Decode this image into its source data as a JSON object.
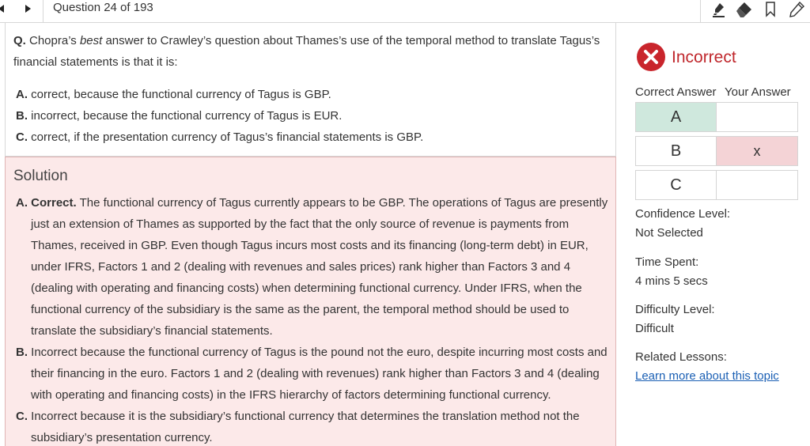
{
  "header": {
    "question_counter": "Question 24 of 193",
    "icons": [
      "triangle-left-icon",
      "triangle-right-icon",
      "highlighter-icon",
      "eraser-icon",
      "bookmark-icon",
      "pencil-icon"
    ]
  },
  "question": {
    "prefix": "Q.",
    "stem_before": " Chopra’s ",
    "stem_emphasis": "best",
    "stem_after": " answer to Crawley’s question about Thames’s use of the temporal method to translate Tagus’s financial statements is that it is:",
    "choices": [
      {
        "letter": "A.",
        "text": " correct, because the functional currency of Tagus is GBP."
      },
      {
        "letter": "B.",
        "text": " incorrect, because the functional currency of Tagus is EUR."
      },
      {
        "letter": "C.",
        "text": " correct, if the presentation currency of Tagus’s financial statements is GBP."
      }
    ]
  },
  "solution": {
    "title": "Solution",
    "items": [
      {
        "letter": "A.",
        "lead": " Correct.",
        "text": " The functional currency of Tagus currently appears to be GBP. The operations of Tagus are presently just an extension of Thames as supported by the fact that the only source of revenue is payments from Thames, received in GBP. Even though Tagus incurs most costs and its financing (long-term debt) in EUR, under IFRS, Factors 1 and 2 (dealing with revenues and sales prices) rank higher than Factors 3 and 4 (dealing with operating and financing costs) when determining functional currency. Under IFRS, when the functional currency of the subsidiary is the same as the parent, the temporal method should be used to translate the subsidiary’s financial statements."
      },
      {
        "letter": "B.",
        "lead": "",
        "text": " Incorrect because the functional currency of Tagus is the pound not the euro, despite incurring most costs and their financing in the euro. Factors 1 and 2 (dealing with revenues) rank higher than Factors 3 and 4 (dealing with operating and financing costs) in the IFRS hierarchy of factors determining functional currency."
      },
      {
        "letter": "C.",
        "lead": "",
        "text": " Incorrect because it is the subsidiary’s functional currency that determines the translation method not the subsidiary’s presentation currency."
      }
    ]
  },
  "result": {
    "status": "Incorrect",
    "status_color": "#c0282d",
    "correct_answer_label": "Correct Answer",
    "your_answer_label": "Your Answer",
    "rows": [
      {
        "letter": "A",
        "correct": true,
        "your_mark": ""
      },
      {
        "letter": "B",
        "correct": false,
        "your_mark": "x"
      },
      {
        "letter": "C",
        "correct": false,
        "your_mark": ""
      }
    ],
    "correct_color": "#cfe8dd",
    "wrong_color": "#f4d3d6"
  },
  "details": {
    "confidence_label": "Confidence Level:",
    "confidence_value": "Not Selected",
    "time_label": "Time Spent:",
    "time_value": "4 mins 5 secs",
    "difficulty_label": "Difficulty Level:",
    "difficulty_value": "Difficult",
    "lessons_label": "Related Lessons:",
    "lessons_link": "Learn more about this topic"
  }
}
